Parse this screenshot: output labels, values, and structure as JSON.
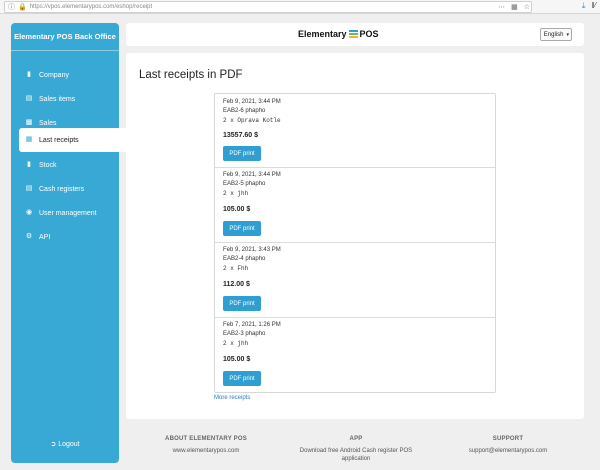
{
  "browser": {
    "url": "https://vpos.elementarypos.com/eshop/receipt",
    "more_icon": "ellipsis-icon",
    "bookmark_icon": "bookmark-icon",
    "star_icon": "star-icon",
    "download_icon": "download-icon",
    "library_icon": "library-icon"
  },
  "sidebar": {
    "title": "Elementary POS Back Office",
    "items": [
      {
        "label": "Company",
        "icon": "building-icon"
      },
      {
        "label": "Sales items",
        "icon": "list-icon"
      },
      {
        "label": "Sales",
        "icon": "chart-icon"
      },
      {
        "label": "Last receipts",
        "icon": "receipt-icon"
      },
      {
        "label": "Stock",
        "icon": "box-icon"
      },
      {
        "label": "Cash registers",
        "icon": "register-icon"
      },
      {
        "label": "User management",
        "icon": "users-icon"
      },
      {
        "label": "API",
        "icon": "gear-icon"
      }
    ],
    "logout": "Logout",
    "accent": "#38a9d4"
  },
  "header": {
    "logo_left": "Elementary",
    "logo_right": "POS",
    "language": "English"
  },
  "main": {
    "title": "Last receipts in PDF",
    "receipts": [
      {
        "date": "Feb 9, 2021, 3:44 PM",
        "name": "EAB2-6 phapho",
        "item": "2 x Oprava Kotle",
        "total": "13557.60 $",
        "button": "PDF print"
      },
      {
        "date": "Feb 9, 2021, 3:44 PM",
        "name": "EAB2-5 phapho",
        "item": "2 x jhh",
        "total": "105.00 $",
        "button": "PDF print"
      },
      {
        "date": "Feb 9, 2021, 3:43 PM",
        "name": "EAB2-4 phapho",
        "item": "2 x Fhh",
        "total": "112.00 $",
        "button": "PDF print"
      },
      {
        "date": "Feb 7, 2021, 1:26 PM",
        "name": "EAB2-3 phapho",
        "item": "2 x jhh",
        "total": "105.00 $",
        "button": "PDF print"
      }
    ],
    "more_link": "More receipts"
  },
  "footer": {
    "about": {
      "heading": "ABOUT ELEMENTARY POS",
      "text": "www.elementarypos.com"
    },
    "app": {
      "heading": "APP",
      "line1": "Download free Android Cash register POS",
      "line2": "application"
    },
    "support": {
      "heading": "SUPPORT",
      "text": "support@elementarypos.com"
    }
  }
}
